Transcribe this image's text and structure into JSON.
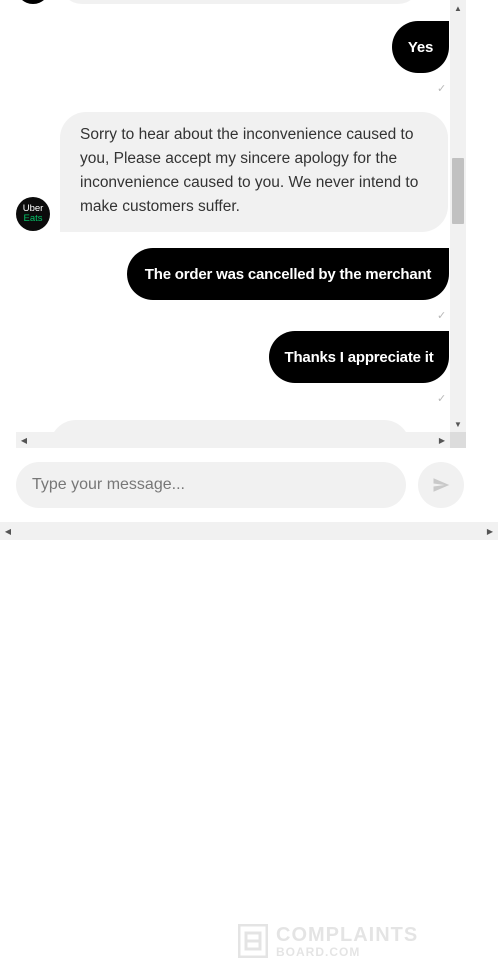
{
  "conversation": {
    "messages": [
      {
        "sender": "user",
        "text": "Yes"
      },
      {
        "sender": "agent",
        "text": "Sorry to hear about the inconvenience caused to you, Please accept my sincere apology for the inconvenience caused to you. We never intend to make customers suffer."
      },
      {
        "sender": "user",
        "text": "The order was cancelled by the merchant"
      },
      {
        "sender": "user",
        "text": "Thanks I appreciate it"
      }
    ],
    "agent_avatar": {
      "line1": "Uber",
      "line2": "Eats",
      "accent_color": "#06c167"
    },
    "read_receipt_icon": "check-icon",
    "read_receipt_glyph": "✓"
  },
  "composer": {
    "placeholder": "Type your message...",
    "send_icon": "send-icon"
  },
  "watermark": {
    "line1": "COMPLAINTS",
    "line2": "BOARD.COM"
  },
  "scrollbars": {
    "up_glyph": "▲",
    "down_glyph": "▼",
    "left_glyph": "◀",
    "right_glyph": "▶"
  },
  "colors": {
    "user_bubble": "#000000",
    "agent_bubble": "#f1f1f1",
    "background": "#ffffff"
  }
}
